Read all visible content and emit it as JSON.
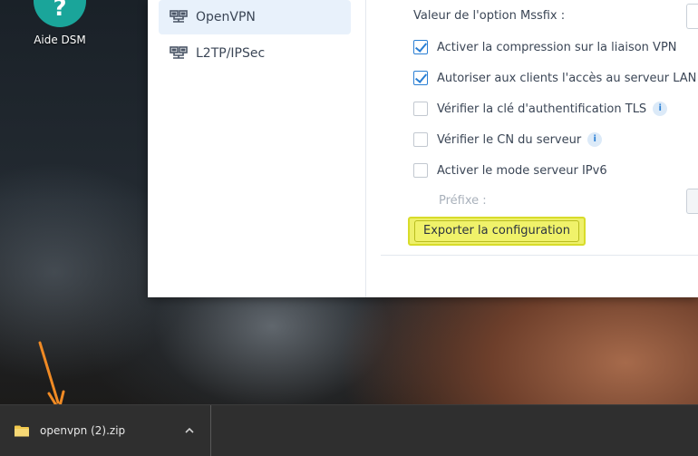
{
  "desktop": {
    "help_icon_glyph": "?",
    "help_label": "Aide DSM"
  },
  "nav": {
    "items": [
      {
        "label": "OpenVPN",
        "icon": "network-icon",
        "active": true
      },
      {
        "label": "L2TP/IPSec",
        "icon": "network-icon",
        "active": false
      }
    ]
  },
  "settings": {
    "mssfix_label": "Valeur de l'option Mssfix :",
    "options": [
      {
        "label": "Activer la compression sur la liaison VPN",
        "checked": true,
        "info": false
      },
      {
        "label": "Autoriser aux clients l'accès au serveur LAN",
        "checked": true,
        "info": false
      },
      {
        "label": "Vérifier la clé d'authentification TLS",
        "checked": false,
        "info": true
      },
      {
        "label": "Vérifier le CN du serveur",
        "checked": false,
        "info": true
      },
      {
        "label": "Activer le mode serveur IPv6",
        "checked": false,
        "info": false
      }
    ],
    "prefix_label": "Préfixe :",
    "info_glyph": "i",
    "export_button": "Exporter la configuration"
  },
  "download_bar": {
    "file_name": "openvpn (2).zip"
  },
  "colors": {
    "accent": "#2a7fd4",
    "highlight": "#eef06a",
    "annotation_arrow": "#f08a24",
    "help_icon": "#1aa59a"
  }
}
